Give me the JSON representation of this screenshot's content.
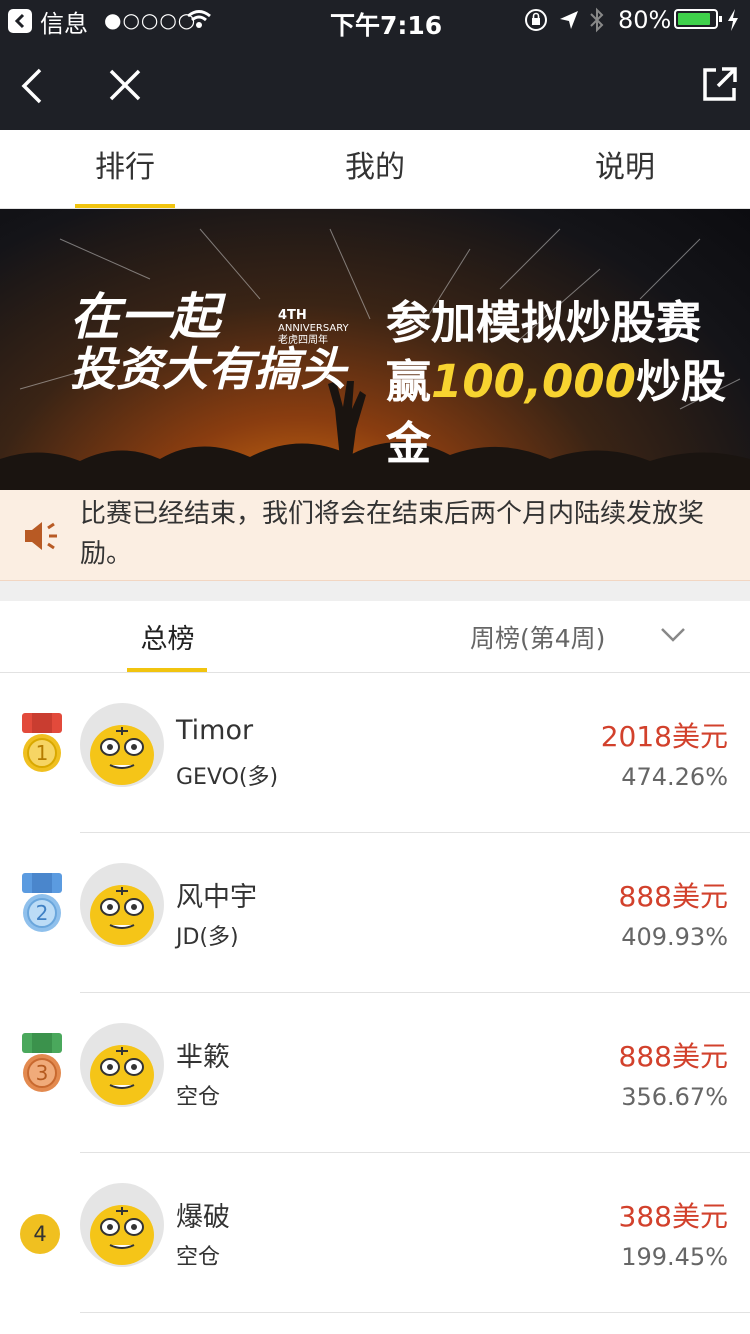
{
  "status_bar": {
    "back_app": "信息",
    "signal": "●○○○○",
    "time": "下午7:16",
    "battery": "80%",
    "battery_level": 0.8
  },
  "tabs": [
    {
      "label": "排行"
    },
    {
      "label": "我的"
    },
    {
      "label": "说明"
    }
  ],
  "banner": {
    "slogan_line1": "在一起",
    "slogan_line2": "投资大有搞头",
    "anniversary_en": "4TH",
    "anniversary_en2": "ANNIVERSARY",
    "anniversary_cn": "老虎四周年",
    "headline1": "参加模拟炒股赛",
    "headline2_prefix": "赢",
    "headline2_amount": "100,000",
    "headline2_suffix": "炒股金"
  },
  "notice": {
    "text": "比赛已经结束，我们将会在结束后两个月内陆续发放奖励。"
  },
  "subtabs": {
    "overall": "总榜",
    "weekly": "周榜(第4周)"
  },
  "ranking": [
    {
      "rank": "1",
      "name": "Timor",
      "position": "GEVO(多)",
      "prize": "2018美元",
      "return": "474.26%"
    },
    {
      "rank": "2",
      "name": "风中宇",
      "position": "JD(多)",
      "prize": "888美元",
      "return": "409.93%"
    },
    {
      "rank": "3",
      "name": "芈簌",
      "position": "空仓",
      "prize": "888美元",
      "return": "356.67%"
    },
    {
      "rank": "4",
      "name": "爆破",
      "position": "空仓",
      "prize": "388美元",
      "return": "199.45%"
    }
  ],
  "colors": {
    "accent": "#f1c40f",
    "prize": "#d2412c",
    "navbar": "#1e2026",
    "notice_bg": "#fbeee2",
    "gold": "#f0c020",
    "silver": "#8fc0ec",
    "bronze": "#e38a4f"
  }
}
